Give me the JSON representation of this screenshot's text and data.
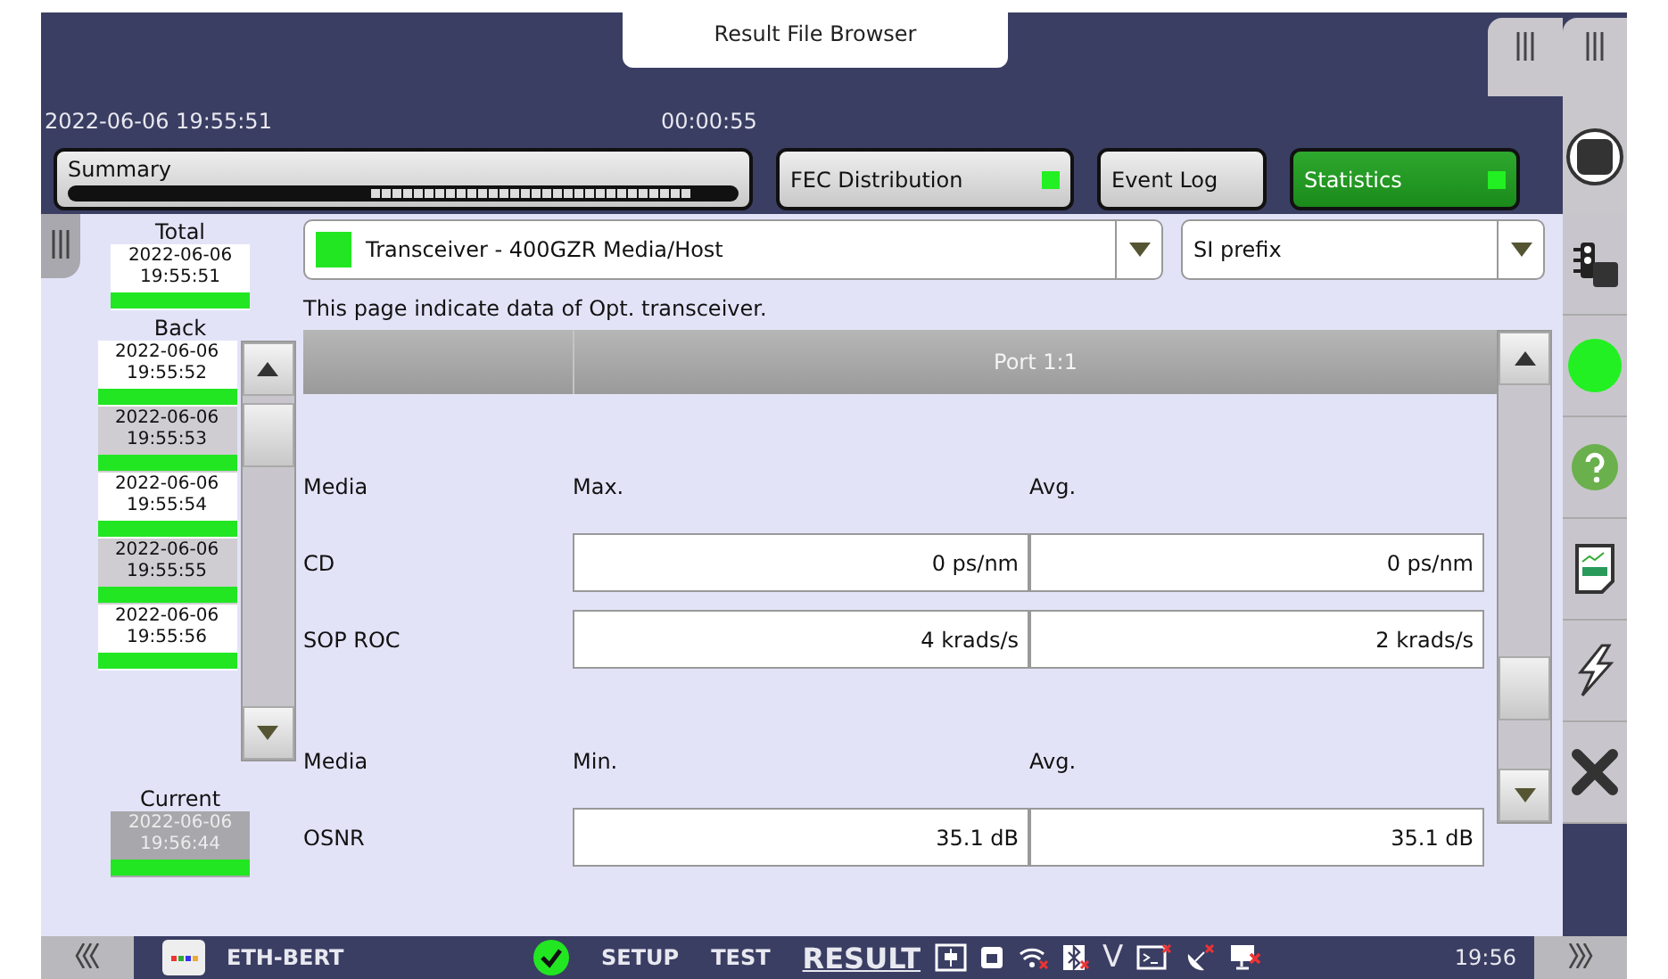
{
  "window": {
    "title": "Result File Browser"
  },
  "header": {
    "datetime": "2022-06-06 19:55:51",
    "elapsed": "00:00:55"
  },
  "tabs": [
    {
      "label": "Summary",
      "kind": "progress",
      "selected": false,
      "indicator": false
    },
    {
      "label": "FEC Distribution",
      "kind": "plain",
      "selected": false,
      "indicator": true
    },
    {
      "label": "Event Log",
      "kind": "plain",
      "selected": false,
      "indicator": false
    },
    {
      "label": "Statistics",
      "kind": "plain",
      "selected": true,
      "indicator": true
    }
  ],
  "results": {
    "total_label": "Total",
    "total": {
      "date": "2022-06-06",
      "time": "19:55:51"
    },
    "back_label": "Back",
    "back": [
      {
        "date": "2022-06-06",
        "time": "19:55:52"
      },
      {
        "date": "2022-06-06",
        "time": "19:55:53"
      },
      {
        "date": "2022-06-06",
        "time": "19:55:54"
      },
      {
        "date": "2022-06-06",
        "time": "19:55:55"
      },
      {
        "date": "2022-06-06",
        "time": "19:55:56"
      }
    ],
    "current_label": "Current",
    "current": {
      "date": "2022-06-06",
      "time": "19:56:44"
    }
  },
  "selectors": [
    {
      "value": "Transceiver - 400GZR Media/Host",
      "color": "#22e622"
    },
    {
      "value": "SI prefix"
    }
  ],
  "description": "This page indicate data of Opt. transceiver.",
  "table": {
    "port": "Port 1:1",
    "sections": [
      {
        "heading": "Media",
        "columns": [
          "Max.",
          "Avg."
        ],
        "rows": [
          {
            "name": "CD",
            "values": [
              "0 ps/nm",
              "0 ps/nm"
            ]
          },
          {
            "name": "SOP ROC",
            "values": [
              "4 krads/s",
              "2 krads/s"
            ]
          }
        ]
      },
      {
        "heading": "Media",
        "columns": [
          "Min.",
          "Avg."
        ],
        "rows": [
          {
            "name": "OSNR",
            "values": [
              "35.1 dB",
              "35.1 dB"
            ]
          }
        ]
      }
    ]
  },
  "rail": [
    {
      "kind": "traffic"
    },
    {
      "kind": "status"
    },
    {
      "kind": "help"
    },
    {
      "kind": "report"
    },
    {
      "kind": "lightning"
    },
    {
      "kind": "close"
    }
  ],
  "status_bar": {
    "app": "ETH-BERT",
    "mode": "V",
    "nav": [
      {
        "label": "SETUP",
        "selected": false
      },
      {
        "label": "TEST",
        "selected": false
      },
      {
        "label": "RESULT",
        "selected": true
      }
    ],
    "time": "19:56"
  }
}
